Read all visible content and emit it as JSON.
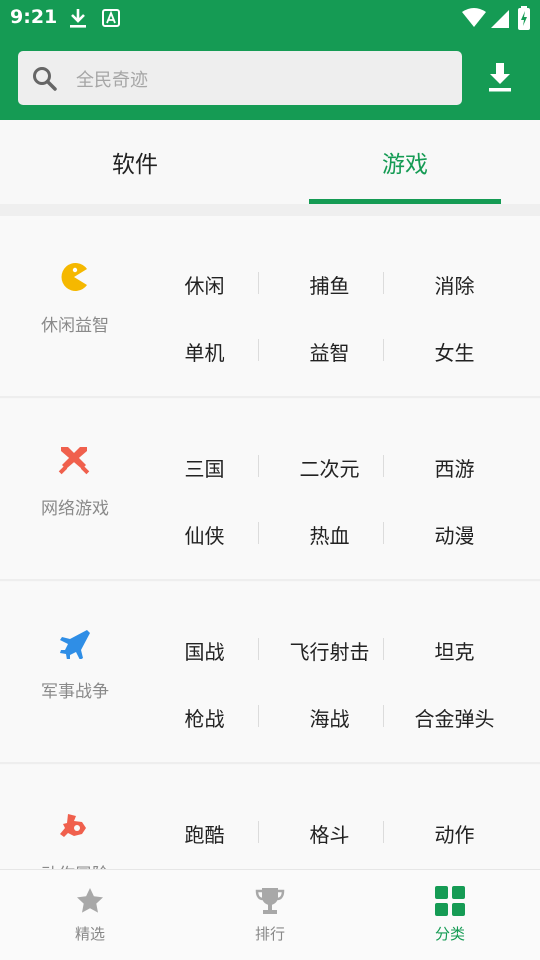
{
  "status_bar": {
    "time": "9:21"
  },
  "search": {
    "placeholder": "全民奇迹"
  },
  "tabs": [
    {
      "label": "软件",
      "active": false
    },
    {
      "label": "游戏",
      "active": true
    }
  ],
  "categories": [
    {
      "label": "休闲益智",
      "icon": "pacman-icon",
      "icon_color": "#f5b800",
      "tags": [
        "休闲",
        "捕鱼",
        "消除",
        "单机",
        "益智",
        "女生"
      ]
    },
    {
      "label": "网络游戏",
      "icon": "crossed-swords-icon",
      "icon_color": "#f0604d",
      "tags": [
        "三国",
        "二次元",
        "西游",
        "仙侠",
        "热血",
        "动漫"
      ]
    },
    {
      "label": "军事战争",
      "icon": "fighter-jet-icon",
      "icon_color": "#2f8ee6",
      "tags": [
        "国战",
        "飞行射击",
        "坦克",
        "枪战",
        "海战",
        "合金弹头"
      ]
    },
    {
      "label": "动作冒险",
      "icon": "fist-icon",
      "icon_color": "#f0604d",
      "tags": [
        "跑酷",
        "格斗",
        "动作"
      ]
    }
  ],
  "bottom_nav": [
    {
      "label": "精选",
      "icon": "star-icon",
      "active": false
    },
    {
      "label": "排行",
      "icon": "trophy-icon",
      "active": false
    },
    {
      "label": "分类",
      "icon": "grid-icon",
      "active": true
    }
  ],
  "colors": {
    "primary": "#159b54",
    "inactive": "#888888"
  }
}
